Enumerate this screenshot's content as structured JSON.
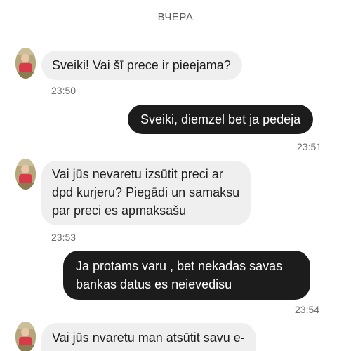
{
  "day_separator": "ВЧЕРА",
  "messages": [
    {
      "direction": "incoming",
      "lines": [
        "Sveiki! Vai šī prece ir pieejama?"
      ],
      "time": "23:50",
      "avatar": "profile-photo"
    },
    {
      "direction": "outgoing",
      "lines": [
        "Sveiki, diemzel bet ja pedeja"
      ],
      "time": "23:51"
    },
    {
      "direction": "incoming",
      "lines": [
        "Vai jūs nevaretu izsūtit preci ar",
        "dpd kurjeru? Piegādi un samaksu",
        "par preci es apmaksašu"
      ],
      "time": "23:53",
      "avatar": "profile-photo"
    },
    {
      "direction": "outgoing",
      "lines": [
        "Ja protams varu , bet nekadas savas",
        "bankas datus es neievedisu"
      ],
      "time": "23:54"
    },
    {
      "direction": "incoming",
      "lines": [
        "Vai jūs nvaretu man atsūtit savu e-"
      ],
      "avatar": "profile-photo"
    }
  ],
  "colors": {
    "incoming_bubble": "#efefef",
    "outgoing_bubble": "#1c1c1c",
    "outgoing_text": "#ffffff",
    "timestamp": "#6d6d6d"
  }
}
